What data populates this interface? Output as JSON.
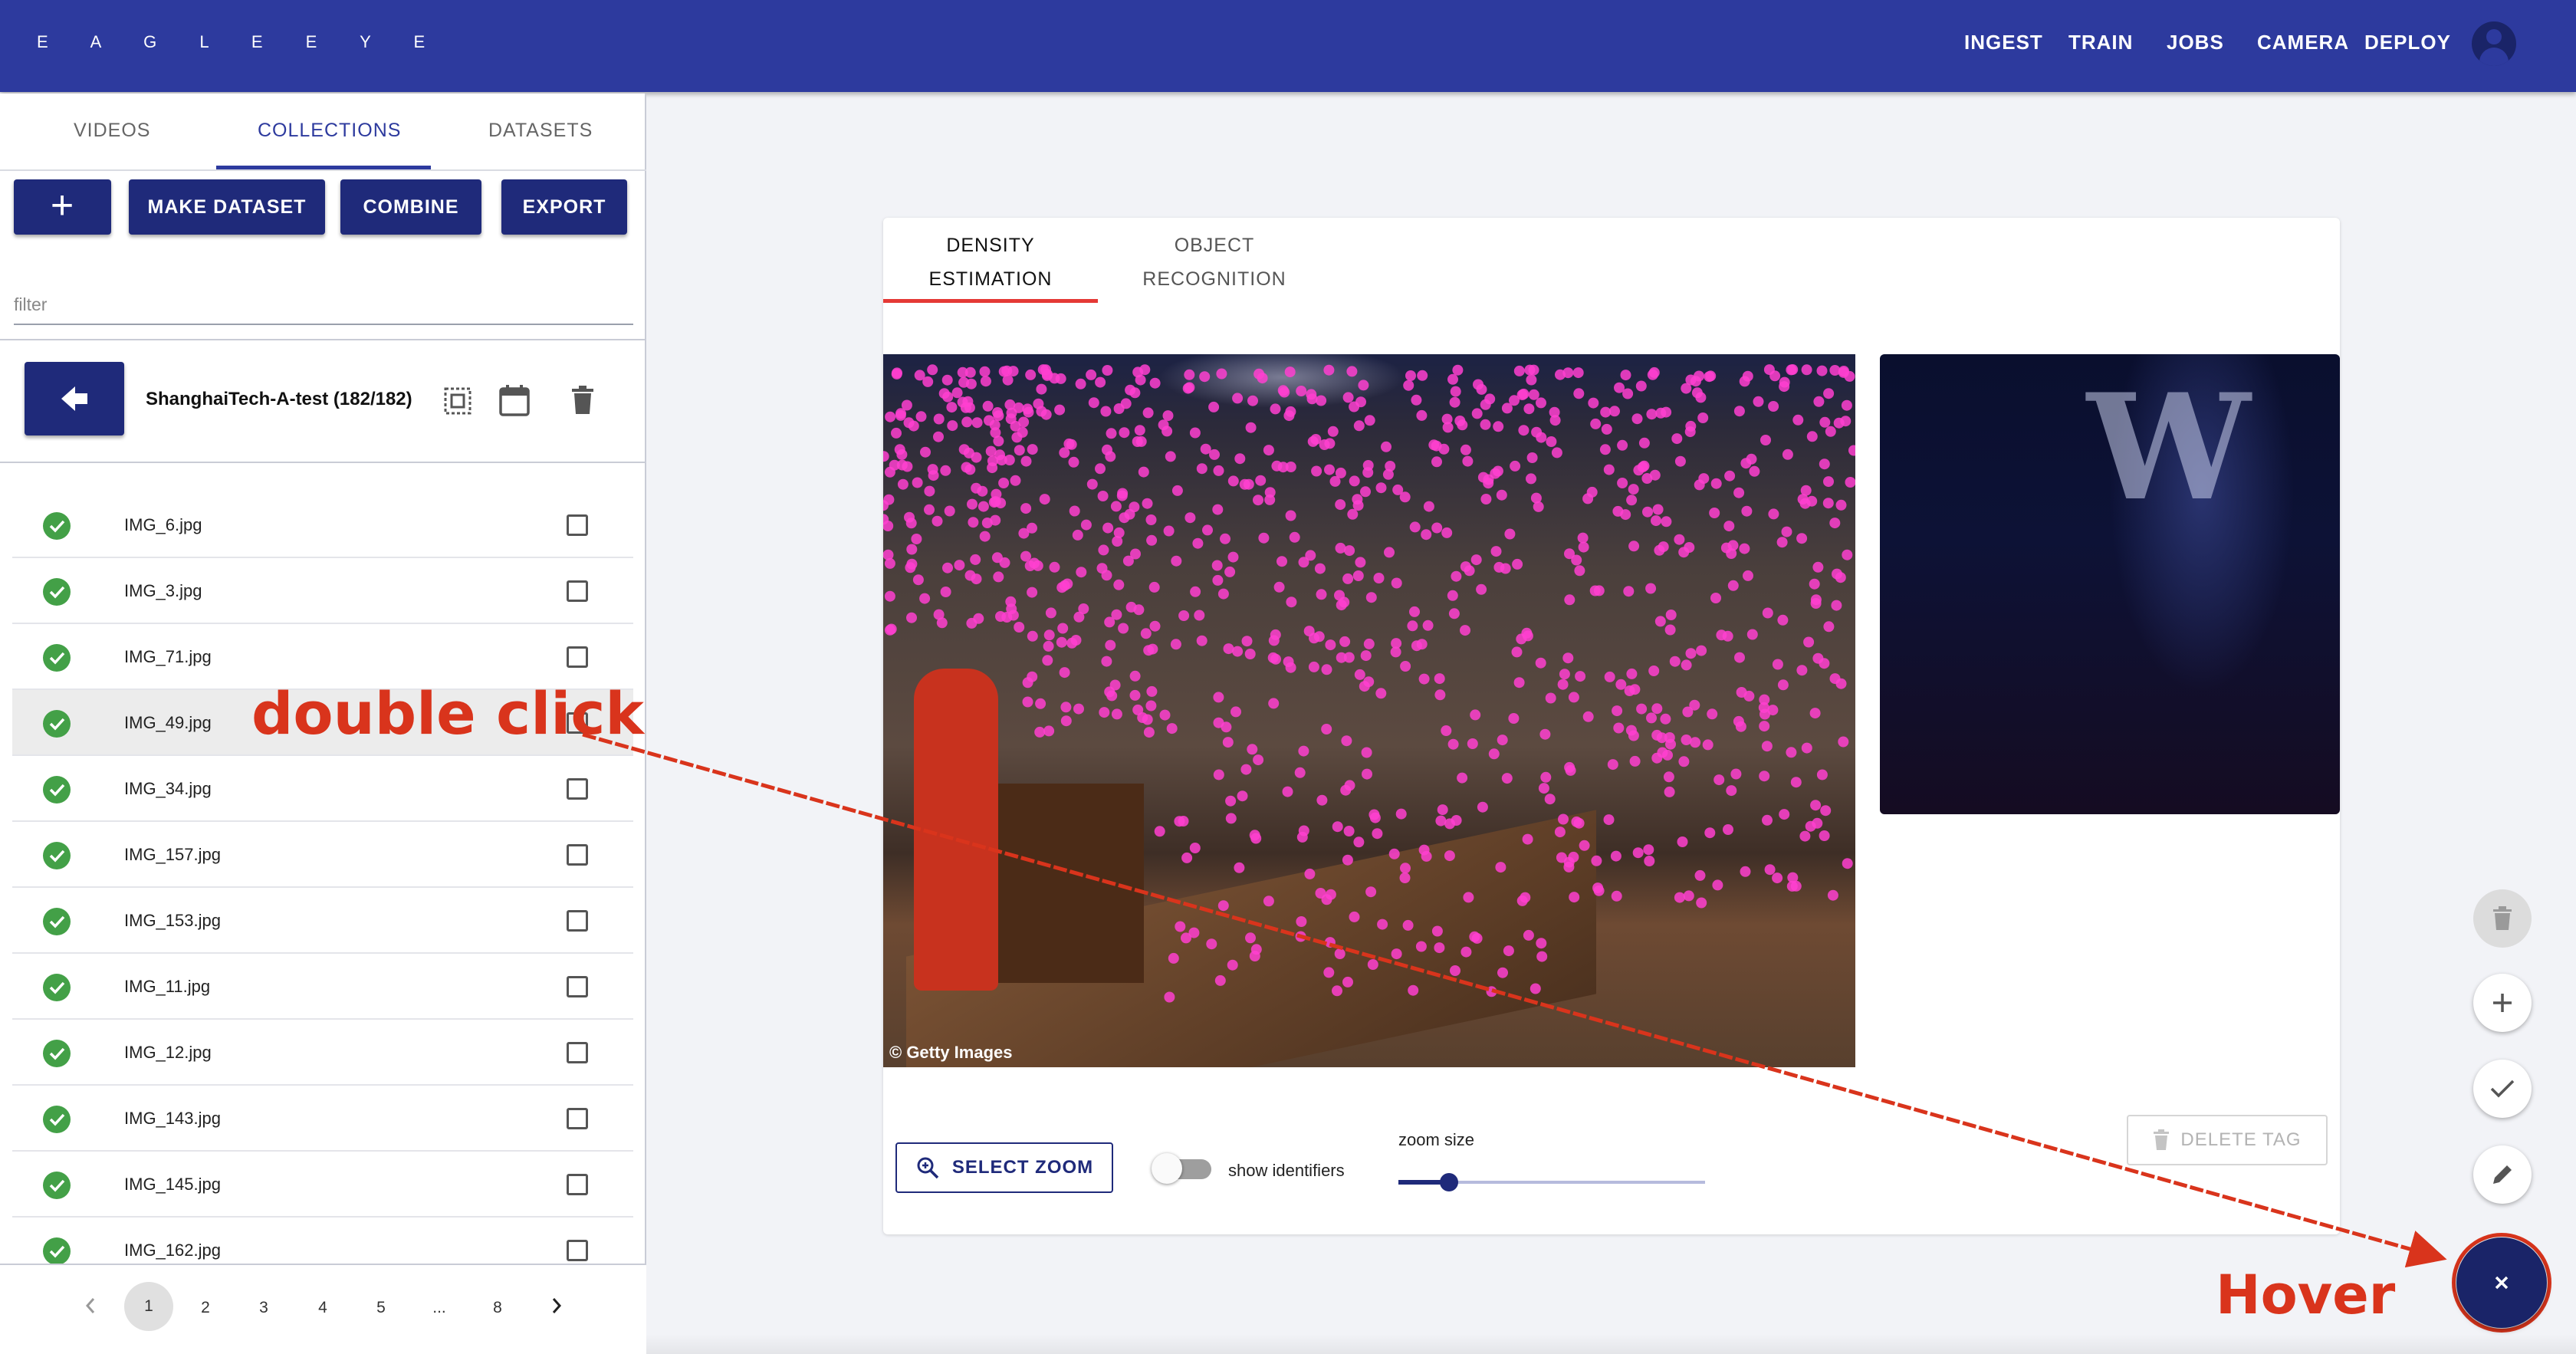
{
  "app": {
    "brand": "E A G L E   E Y E",
    "nav": [
      "INGEST",
      "TRAIN",
      "JOBS",
      "CAMERA",
      "DEPLOY"
    ]
  },
  "sidebar": {
    "tabs": [
      "VIDEOS",
      "COLLECTIONS",
      "DATASETS"
    ],
    "active_tab": "COLLECTIONS",
    "buttons": {
      "add": "+",
      "make_dataset": "MAKE DATASET",
      "combine": "COMBINE",
      "export": "EXPORT"
    },
    "filter_placeholder": "filter",
    "collection_title": "ShanghaiTech-A-test (182/182)",
    "files": [
      {
        "name": "IMG_6.jpg"
      },
      {
        "name": "IMG_3.jpg"
      },
      {
        "name": "IMG_71.jpg"
      },
      {
        "name": "IMG_49.jpg"
      },
      {
        "name": "IMG_34.jpg"
      },
      {
        "name": "IMG_157.jpg"
      },
      {
        "name": "IMG_153.jpg"
      },
      {
        "name": "IMG_11.jpg"
      },
      {
        "name": "IMG_12.jpg"
      },
      {
        "name": "IMG_143.jpg"
      },
      {
        "name": "IMG_145.jpg"
      },
      {
        "name": "IMG_162.jpg"
      }
    ],
    "highlighted_file": "IMG_49.jpg",
    "pagination": {
      "pages": [
        "1",
        "2",
        "3",
        "4",
        "5",
        "...",
        "8"
      ],
      "current": "1"
    }
  },
  "main": {
    "tabs": [
      {
        "line1": "DENSITY",
        "line2": "ESTIMATION"
      },
      {
        "line1": "OBJECT",
        "line2": "RECOGNITION"
      }
    ],
    "image_credit": "© Getty Images",
    "select_zoom_label": "SELECT ZOOM",
    "show_identifiers_label": "show identifiers",
    "show_identifiers_on": false,
    "zoom_size_label": "zoom size",
    "zoom_size_value": 0.17,
    "delete_tag_label": "DELETE TAG"
  },
  "fabs": [
    "trash-icon",
    "plus-icon",
    "check-icon",
    "pencil-icon",
    "close-icon"
  ],
  "annotations": {
    "double_click": "double click",
    "hover": "Hover"
  },
  "colors": {
    "primary": "#2d3a9e",
    "button": "#1f2a7a",
    "success": "#43a047",
    "annotation": "#d9341c",
    "tab_indicator": "#e53935",
    "dot": "#ff3fd0"
  }
}
